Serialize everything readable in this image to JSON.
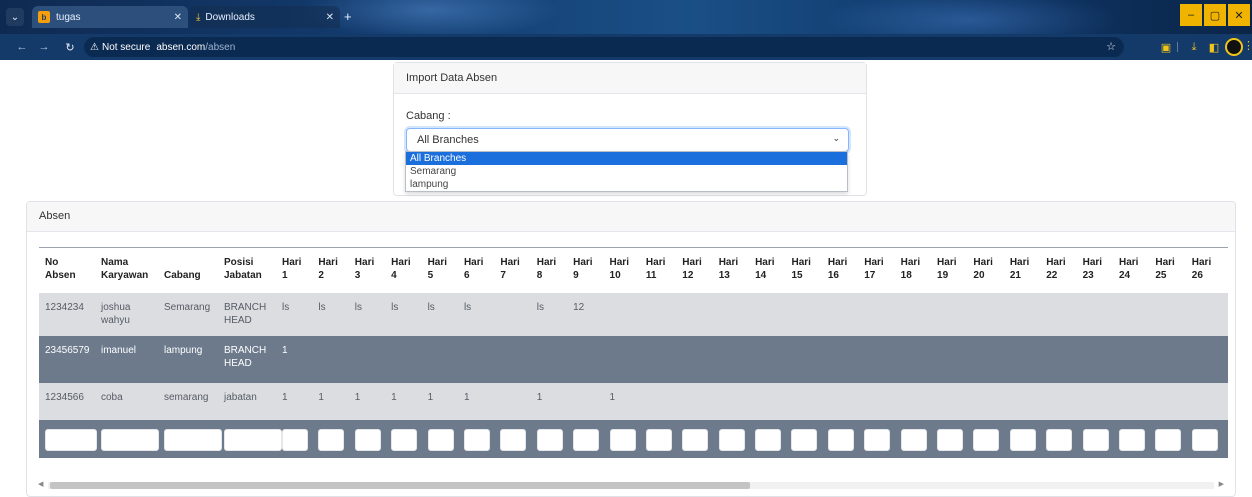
{
  "browser": {
    "tabs": [
      {
        "title": "tugas",
        "favicon_letter": "b"
      },
      {
        "title": "Downloads"
      }
    ],
    "new_tab_symbol": "+",
    "window_controls": {
      "minimize": "–",
      "maximize": "▢",
      "close": "✕"
    },
    "security_label": "Not secure",
    "url_host": "absen.com",
    "url_path": "/absen"
  },
  "import_card": {
    "title": "Import Data Absen",
    "cabang_label": "Cabang :",
    "selected": "All Branches",
    "options": [
      "All Branches",
      "Semarang",
      "lampung"
    ]
  },
  "absen_card": {
    "title": "Absen",
    "columns": {
      "no_absen": [
        "No",
        "Absen"
      ],
      "nama": [
        "Nama",
        "Karyawan"
      ],
      "cabang": "Cabang",
      "posisi": [
        "Posisi",
        "Jabatan"
      ],
      "hari_word": "Hari",
      "hari_numbers": [
        "1",
        "2",
        "3",
        "4",
        "5",
        "6",
        "7",
        "8",
        "9",
        "10",
        "11",
        "12",
        "13",
        "14",
        "15",
        "16",
        "17",
        "18",
        "19",
        "20",
        "21",
        "22",
        "23",
        "24",
        "25",
        "26"
      ]
    },
    "rows": [
      {
        "no": "1234234",
        "nama": [
          "joshua",
          "wahyu"
        ],
        "cabang": "Semarang",
        "posisi": [
          "BRANCH",
          "HEAD"
        ],
        "hari": [
          "ls",
          "ls",
          "ls",
          "ls",
          "ls",
          "ls",
          "",
          "ls",
          "12",
          "",
          "",
          "",
          "",
          "",
          "",
          "",
          "",
          "",
          "",
          "",
          "",
          "",
          "",
          "",
          "",
          ""
        ]
      },
      {
        "no": "23456579",
        "nama": [
          "imanuel"
        ],
        "cabang": "lampung",
        "posisi": [
          "BRANCH",
          "HEAD"
        ],
        "hari": [
          "1",
          "",
          "",
          "",
          "",
          "",
          "",
          "",
          "",
          "",
          "",
          "",
          "",
          "",
          "",
          "",
          "",
          "",
          "",
          "",
          "",
          "",
          "",
          "",
          "",
          ""
        ]
      },
      {
        "no": "1234566",
        "nama": [
          "coba"
        ],
        "cabang": "semarang",
        "posisi": [
          "jabatan"
        ],
        "hari": [
          "1",
          "1",
          "1",
          "1",
          "1",
          "1",
          "",
          "1",
          "",
          "1",
          "",
          "",
          "",
          "",
          "",
          "",
          "",
          "",
          "",
          "",
          "",
          "",
          "",
          "",
          "",
          ""
        ]
      }
    ]
  }
}
